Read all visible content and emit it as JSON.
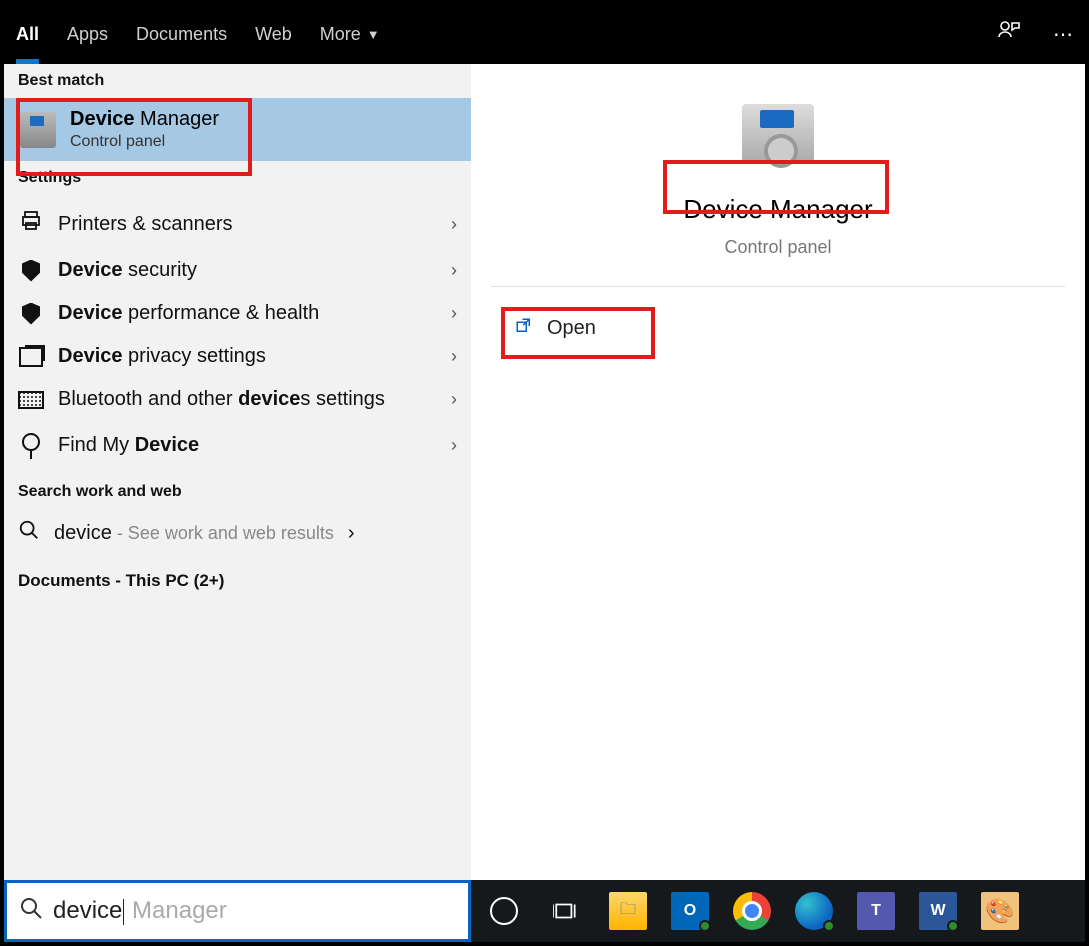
{
  "filter": {
    "tabs": [
      "All",
      "Apps",
      "Documents",
      "Web",
      "More"
    ],
    "active_index": 0
  },
  "left": {
    "best_match_label": "Best match",
    "best_match": {
      "title_bold": "Device",
      "title_rest": " Manager",
      "subtitle": "Control panel"
    },
    "settings_label": "Settings",
    "settings_items": [
      {
        "icon": "printer",
        "pre": "",
        "bold": "",
        "post": "Printers & scanners"
      },
      {
        "icon": "shield",
        "pre": "",
        "bold": "Device",
        "post": " security"
      },
      {
        "icon": "shield",
        "pre": "",
        "bold": "Device",
        "post": " performance & health"
      },
      {
        "icon": "screens",
        "pre": "",
        "bold": "Device",
        "post": " privacy settings"
      },
      {
        "icon": "keyboard",
        "pre": "Bluetooth and other ",
        "bold": "device",
        "post": "s settings"
      },
      {
        "icon": "location",
        "pre": "Find My ",
        "bold": "Device",
        "post": ""
      }
    ],
    "work_web_label": "Search work and web",
    "work_web_item": {
      "term": "device",
      "suffix": " - See work and web results"
    },
    "documents_label": "Documents - This PC (2+)"
  },
  "right": {
    "title": "Device Manager",
    "subtitle": "Control panel",
    "open_label": "Open"
  },
  "search": {
    "typed": "device",
    "suggestion": " Manager"
  },
  "taskbar": {
    "icons": [
      "cortana",
      "taskview",
      "explorer",
      "outlook",
      "chrome",
      "edge",
      "teams",
      "word",
      "paint"
    ]
  }
}
